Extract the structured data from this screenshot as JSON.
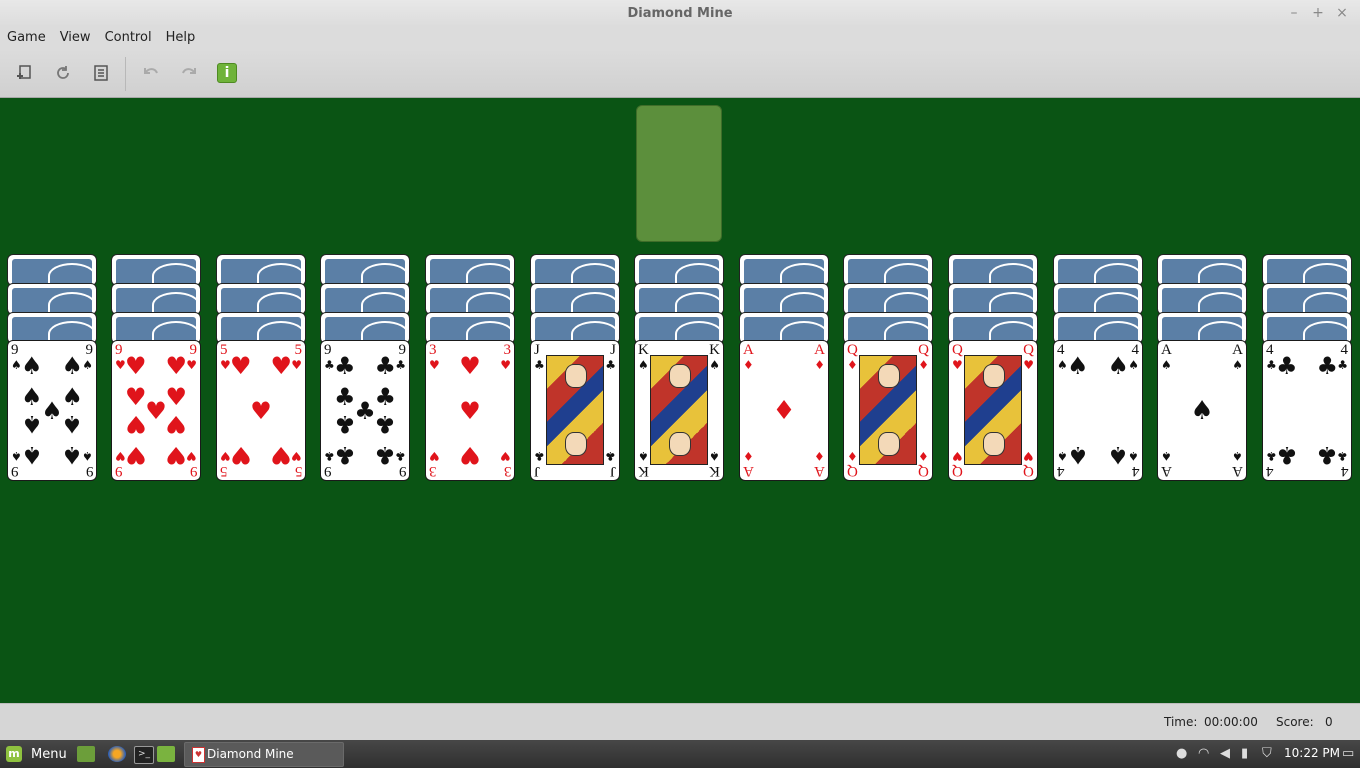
{
  "window": {
    "title": "Diamond Mine"
  },
  "window_controls": {
    "minimize": "–",
    "maximize": "+",
    "close": "×"
  },
  "menu": [
    "Game",
    "View",
    "Control",
    "Help"
  ],
  "toolbar": {
    "new_game_icon": "new-game-icon",
    "restart_icon": "restart-icon",
    "select_game_icon": "select-game-icon",
    "undo_icon": "undo-icon",
    "redo_icon": "redo-icon",
    "hint_icon": "info-icon"
  },
  "status": {
    "time_label": "Time:",
    "time_value": "00:00:00",
    "score_label": "Score:",
    "score_value": "0"
  },
  "taskbar": {
    "menu_label": "Menu",
    "task_label": "Diamond Mine",
    "clock": "10:22 PM"
  },
  "piles": [
    {
      "rank": "9",
      "suit": "♠",
      "color": "black"
    },
    {
      "rank": "9",
      "suit": "♥",
      "color": "red"
    },
    {
      "rank": "5",
      "suit": "♥",
      "color": "red"
    },
    {
      "rank": "9",
      "suit": "♣",
      "color": "black"
    },
    {
      "rank": "3",
      "suit": "♥",
      "color": "red"
    },
    {
      "rank": "J",
      "suit": "♣",
      "color": "black"
    },
    {
      "rank": "K",
      "suit": "♠",
      "color": "black"
    },
    {
      "rank": "A",
      "suit": "♦",
      "color": "red"
    },
    {
      "rank": "Q",
      "suit": "♦",
      "color": "red"
    },
    {
      "rank": "Q",
      "suit": "♥",
      "color": "red"
    },
    {
      "rank": "4",
      "suit": "♠",
      "color": "black"
    },
    {
      "rank": "A",
      "suit": "♠",
      "color": "black"
    },
    {
      "rank": "4",
      "suit": "♣",
      "color": "black"
    }
  ],
  "colors": {
    "felt": "#0a5414",
    "foundation": "#5c8f3c",
    "card_back": "#5b7fa6",
    "red_suit": "#e0141b"
  }
}
